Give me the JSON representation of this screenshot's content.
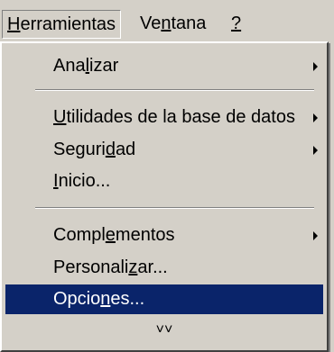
{
  "menubar": {
    "items": [
      {
        "pre": "",
        "key": "H",
        "post": "erramientas"
      },
      {
        "pre": "Ve",
        "key": "n",
        "post": "tana"
      },
      {
        "pre": "",
        "key": "?",
        "post": ""
      }
    ]
  },
  "menu": {
    "items": [
      {
        "pre": "Ana",
        "key": "l",
        "post": "izar",
        "submenu": true
      },
      {
        "pre": "",
        "key": "U",
        "post": "tilidades de la base de datos",
        "submenu": true
      },
      {
        "pre": "Seguri",
        "key": "d",
        "post": "ad",
        "submenu": true
      },
      {
        "pre": "",
        "key": "I",
        "post": "nicio...",
        "submenu": false
      },
      {
        "pre": "Compl",
        "key": "e",
        "post": "mentos",
        "submenu": true
      },
      {
        "pre": "Personali",
        "key": "z",
        "post": "ar...",
        "submenu": false
      },
      {
        "pre": "Opcio",
        "key": "n",
        "post": "es...",
        "submenu": false,
        "selected": true
      }
    ],
    "expand_glyph": "˅˅"
  },
  "colors": {
    "face": "#d4d0c8",
    "highlight": "#0a246a",
    "highlight_text": "#ffffff"
  }
}
